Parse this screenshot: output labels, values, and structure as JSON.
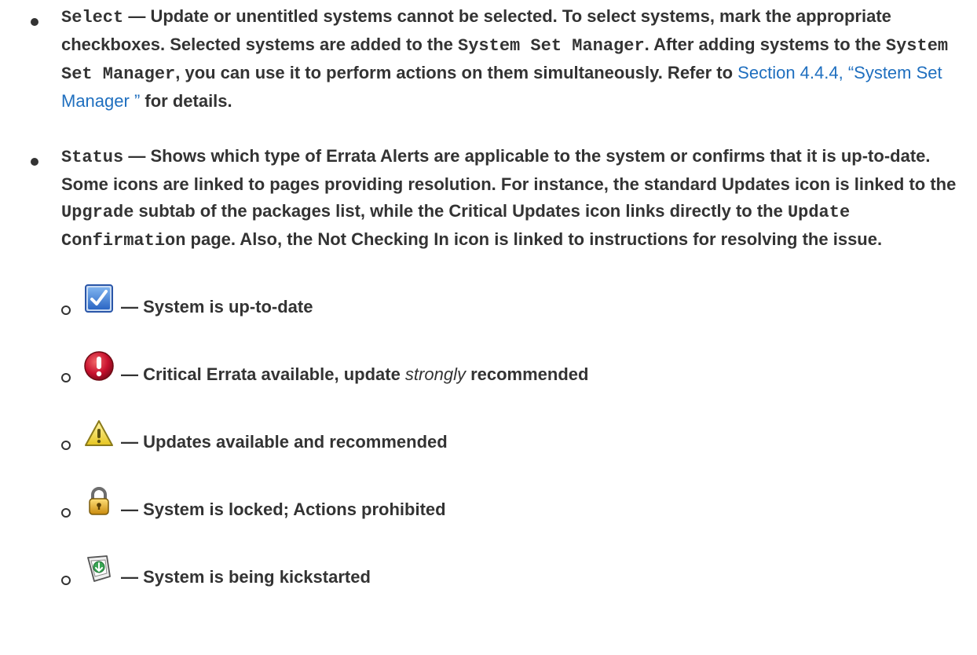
{
  "select": {
    "term": "Select",
    "text_1": " — Update or unentitled systems cannot be selected. To select systems, mark the appropriate checkboxes. Selected systems are added to the ",
    "ssm_1": "System Set Manager",
    "text_2": ". After adding systems to the ",
    "ssm_2": "System Set Manager",
    "text_3": ", you can use it to perform actions on them simultaneously. Refer to ",
    "link": "Section 4.4.4, “System Set Manager ”",
    "text_4": " for details."
  },
  "status": {
    "term": "Status",
    "text_1": " — Shows which type of Errata Alerts are applicable to the system or confirms that it is up-to-date. Some icons are linked to pages providing resolution. For instance, the standard Updates icon is linked to the ",
    "upgrade": "Upgrade",
    "text_2": " subtab of the packages list, while the Critical Updates icon links directly to the ",
    "update_confirmation": "Update Confirmation",
    "text_3": " page. Also, the Not Checking In icon is linked to instructions for resolving the issue."
  },
  "status_icons": [
    {
      "icon": "checkbox-icon",
      "text": "— System is up-to-date"
    },
    {
      "icon": "critical-icon",
      "text_before": "— Critical Errata available, update ",
      "emph": "strongly",
      "text_after": " recommended"
    },
    {
      "icon": "warning-icon",
      "text": "— Updates available and recommended"
    },
    {
      "icon": "lock-icon",
      "text": "— System is locked; Actions prohibited"
    },
    {
      "icon": "kickstart-icon",
      "text": "— System is being kickstarted"
    }
  ],
  "colors": {
    "text": "#333333",
    "link": "#1f6fbf",
    "check_blue": "#3d7fd6",
    "critical_red": "#c8102e",
    "warning_yellow": "#f2dc3d",
    "lock_gold": "#e0a81c",
    "kickstart_green": "#3aa655"
  }
}
